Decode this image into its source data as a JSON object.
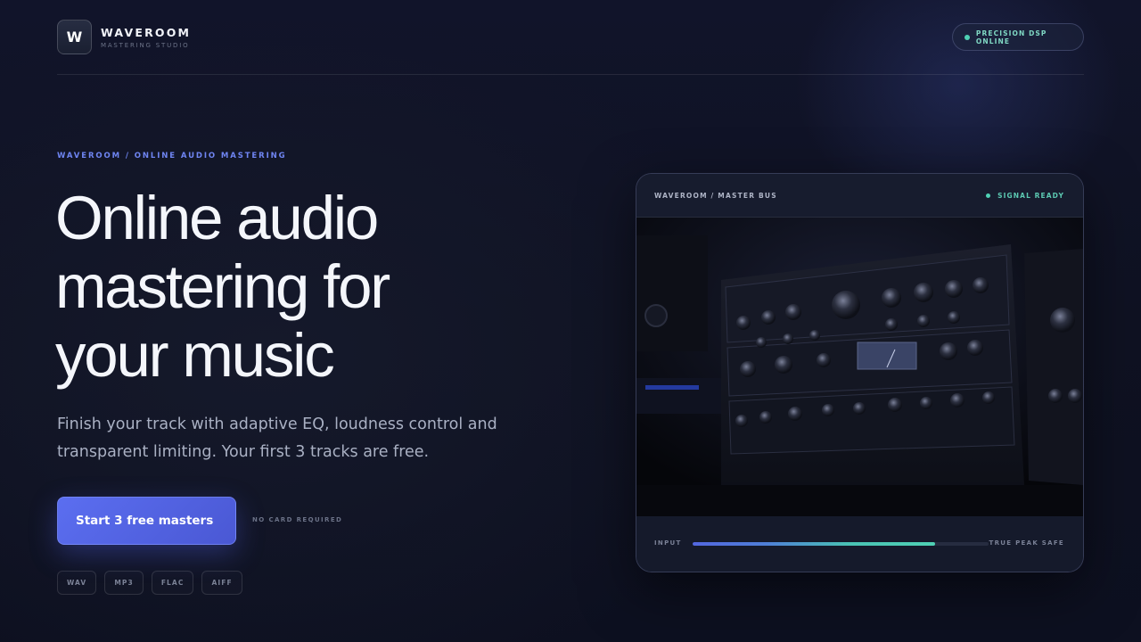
{
  "header": {
    "logo_letter": "W",
    "brand_name": "WAVEROOM",
    "brand_subtitle": "MASTERING STUDIO",
    "status_text": "PRECISION DSP ONLINE"
  },
  "hero": {
    "eyebrow": "WAVEROOM / ONLINE AUDIO MASTERING",
    "headline_lines": [
      "Online audio",
      "mastering for",
      "your music"
    ],
    "subhead": "Finish your track with adaptive EQ, loudness control and transparent limiting. Your first 3 tracks are free.",
    "cta_label": "Start 3 free masters",
    "cta_note": "NO CARD REQUIRED",
    "formats": [
      "WAV",
      "MP3",
      "FLAC",
      "AIFF"
    ]
  },
  "panel": {
    "title": "WAVEROOM / MASTER BUS",
    "status": "SIGNAL READY",
    "meter_left_label": "INPUT",
    "meter_right_label": "TRUE PEAK SAFE",
    "meter_level": 0.82
  },
  "colors": {
    "accent": "#5b6ef0",
    "status_green": "#4fd1b4",
    "background": "#0f1220"
  },
  "icons": {
    "status_dot": "status-dot-icon"
  }
}
